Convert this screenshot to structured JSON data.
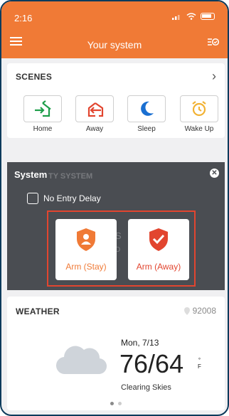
{
  "status_bar": {
    "time": "2:16"
  },
  "header": {
    "title": "Your system"
  },
  "scenes": {
    "title": "SCENES",
    "items": [
      {
        "label": "Home",
        "icon": "home-arrive-icon",
        "color": "#1e9e4a"
      },
      {
        "label": "Away",
        "icon": "home-leave-icon",
        "color": "#e2452f"
      },
      {
        "label": "Sleep",
        "icon": "moon-icon",
        "color": "#1a6fd1"
      },
      {
        "label": "Wake Up",
        "icon": "alarm-clock-icon",
        "color": "#f2b233"
      }
    ]
  },
  "security": {
    "title": "System",
    "background_label": "TY SYSTEM",
    "no_entry_delay": "No Entry Delay",
    "arm_stay": "Arm (Stay)",
    "arm_away": "Arm (Away)",
    "colors": {
      "stay": "#f07a36",
      "away": "#e2452f"
    }
  },
  "weather": {
    "title": "WEATHER",
    "zip": "92008",
    "date": "Mon, 7/13",
    "temps": "76/64",
    "unit_deg": "°",
    "unit_f": "F",
    "condition": "Clearing Skies"
  }
}
